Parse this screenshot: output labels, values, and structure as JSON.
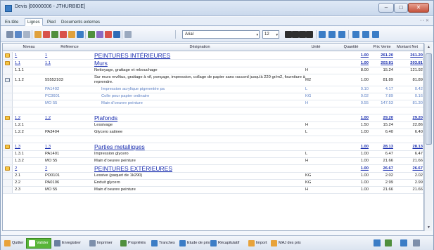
{
  "window": {
    "title": "Devis [00000006 - JTHURBIDE]",
    "min": "‒",
    "max": "□",
    "close": "✕"
  },
  "tabs": [
    {
      "label": "En-tête"
    },
    {
      "label": "Lignes"
    },
    {
      "label": "Pied"
    },
    {
      "label": "Documents externes"
    }
  ],
  "tabs_right": "▫ ▫ ✕",
  "toolbar": {
    "font": "Arial",
    "size": "12",
    "dropdown": "▾"
  },
  "columns": [
    "Niveau",
    "Référence",
    "Désignation",
    "Unité",
    "Quantité",
    "Prix Vente",
    "Montant Net"
  ],
  "rows": [
    {
      "type": "section",
      "icon": "warning-icon",
      "num": "1",
      "ref": "1",
      "des": "PEINTURES INTÉRIEURES",
      "unit": "",
      "qty": "1.00",
      "pv": "261.20",
      "mt": "261.20"
    },
    {
      "type": "section",
      "icon": "warning-icon",
      "num": "1.1",
      "ref": "1.1",
      "des": "Murs",
      "unit": "",
      "qty": "1.00",
      "pv": "203.81",
      "mt": "203.81"
    },
    {
      "type": "line",
      "icon": "",
      "num": "1.1.1",
      "ref": "",
      "des": "Nettoyage, grattage et rebouchage",
      "unit": "H",
      "qty": "8.00",
      "pv": "15.24",
      "mt": "121.92"
    },
    {
      "type": "line-multi",
      "icon": "document-icon",
      "num": "1.1.2",
      "ref": "55552103",
      "des": "Sur murs revêtus, grattage à vif, ponçage, impression, collage de papier sans raccord jusqu'à 220 gr/m2, fourniture à reprendre.",
      "unit": "M2",
      "qty": "1.00",
      "pv": "81.89",
      "mt": "81.89"
    },
    {
      "type": "detail",
      "icon": "",
      "num": "",
      "ref": "PA1402",
      "des": "Impression acrylique pigmentée pa",
      "unit": "L",
      "qty": "0.10",
      "pv": "4.17",
      "mt": "0.42"
    },
    {
      "type": "detail",
      "icon": "",
      "num": "",
      "ref": "PC3601",
      "des": "Colle pour papier ordinaire",
      "unit": "KG",
      "qty": "0.02",
      "pv": "7.89",
      "mt": "0.16"
    },
    {
      "type": "detail",
      "icon": "",
      "num": "",
      "ref": "MO 55",
      "des": "Main d'oeuvre peinture",
      "unit": "H",
      "qty": "0.55",
      "pv": "147.53",
      "mt": "81.30"
    },
    {
      "type": "empty",
      "icon": "",
      "num": "",
      "ref": "",
      "des": "",
      "unit": "",
      "qty": "",
      "pv": "",
      "mt": ""
    },
    {
      "type": "section",
      "icon": "warning-icon",
      "num": "1.2",
      "ref": "1.2",
      "des": "Plafonds",
      "unit": "",
      "qty": "1.00",
      "pv": "29.20",
      "mt": "29.20"
    },
    {
      "type": "line",
      "icon": "",
      "num": "1.2.1",
      "ref": "",
      "des": "Lessivage",
      "unit": "H",
      "qty": "1.50",
      "pv": "15.24",
      "mt": "22.86"
    },
    {
      "type": "line",
      "icon": "",
      "num": "1.2.2",
      "ref": "PA3404",
      "des": "Glycero satinee",
      "unit": "L",
      "qty": "1.00",
      "pv": "6.40",
      "mt": "6.40"
    },
    {
      "type": "empty",
      "icon": "",
      "num": "",
      "ref": "",
      "des": "",
      "unit": "",
      "qty": "",
      "pv": "",
      "mt": ""
    },
    {
      "type": "section",
      "icon": "warning-icon",
      "num": "1.3",
      "ref": "1.3",
      "des": "Parties metalliques",
      "unit": "",
      "qty": "1.00",
      "pv": "28.13",
      "mt": "28.13"
    },
    {
      "type": "line",
      "icon": "",
      "num": "1.3.1",
      "ref": "PA1401",
      "des": "Impression glycero",
      "unit": "L",
      "qty": "1.00",
      "pv": "6.47",
      "mt": "6.47"
    },
    {
      "type": "line",
      "icon": "",
      "num": "1.3.2",
      "ref": "MO 55",
      "des": "Main d'oeuvre peinture",
      "unit": "H",
      "qty": "1.00",
      "pv": "21.66",
      "mt": "21.66"
    },
    {
      "type": "section",
      "icon": "warning-icon",
      "num": "2",
      "ref": "2",
      "des": "PEINTURES EXTÉRIEURES",
      "unit": "",
      "qty": "1.00",
      "pv": "26.67",
      "mt": "26.67"
    },
    {
      "type": "line",
      "icon": "",
      "num": "2.1",
      "ref": "PD0101",
      "des": "Lessive (paquet de 1k290)",
      "unit": "KG",
      "qty": "1.00",
      "pv": "2.02",
      "mt": "2.02"
    },
    {
      "type": "line",
      "icon": "",
      "num": "2.2",
      "ref": "PA0106",
      "des": "Enduit glycero",
      "unit": "KG",
      "qty": "1.00",
      "pv": "2.99",
      "mt": "2.99"
    },
    {
      "type": "line",
      "icon": "",
      "num": "2.3",
      "ref": "MO 55",
      "des": "Main d'oeuvre peinture",
      "unit": "H",
      "qty": "1.00",
      "pv": "21.66",
      "mt": "21.66"
    }
  ],
  "scrollbar": {
    "up": "▲",
    "down": "▼"
  },
  "bottom": [
    {
      "label": "Quitter",
      "color": "#e8a33a"
    },
    {
      "label": "Valider",
      "color": "#ffffff"
    },
    {
      "label": "Enregistrer",
      "color": "#6a7fa0"
    },
    {
      "label": "Imprimer",
      "color": "#7d8fab"
    },
    {
      "label": "Propriétés",
      "color": "#4f8f3d"
    },
    {
      "label": "Tranches",
      "color": "#3b7dc6"
    },
    {
      "label": "Etude de prix",
      "color": "#3b7dc6"
    },
    {
      "label": "Récapitulatif",
      "color": "#3b7dc6"
    },
    {
      "label": "Import",
      "color": "#e8a33a"
    },
    {
      "label": "MAJ des prix",
      "color": "#e8a33a"
    }
  ],
  "toolbar_colors": [
    "#7d8fab",
    "#5b88c7",
    "#a7b4c8",
    "#e0a13c",
    "#d8534b",
    "#4f8f3d",
    "#d8534b",
    "#e0a13c",
    "#3b7dc6",
    "#4f8f3d",
    "#8a6cc4",
    "#d8534b",
    "#2d6bb7",
    "#9aa9bf",
    "#2f2f2f",
    "#2f2f2f",
    "#2f2f2f",
    "#2f2f2f",
    "#3b7dc6",
    "#3b7dc6",
    "#3b7dc6",
    "#3b7dc6",
    "#3b7dc6",
    "#3b7dc6"
  ]
}
